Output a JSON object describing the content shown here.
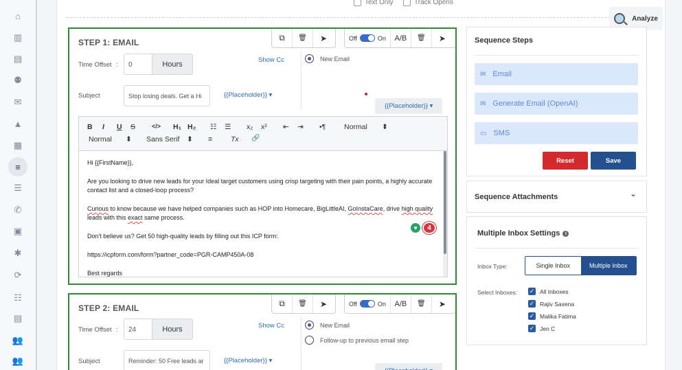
{
  "sidebar": {
    "icons": [
      "home-icon",
      "bank-icon",
      "contacts-icon",
      "users-icon",
      "mail-icon",
      "flask-icon",
      "campaign-icon",
      "sequence-icon",
      "tasks-icon",
      "phone-icon",
      "document-icon",
      "bug-icon",
      "refresh-icon",
      "list-icon",
      "report-icon",
      "team-icon"
    ],
    "glyphs": [
      "⌂",
      "▥",
      "▤",
      "⚉",
      "✉",
      "▲",
      "▦",
      "≡",
      "☰",
      "✆",
      "▣",
      "✱",
      "⟳",
      "☷",
      "▤",
      "👥"
    ],
    "active_index": 7
  },
  "top": {
    "text_only": "Text Only",
    "track_opens": "Track Opens",
    "analyze": "Analyze"
  },
  "step1": {
    "title": "STEP 1: EMAIL",
    "toolbar_toggle_off": "Off",
    "toolbar_toggle_on": "On",
    "ab": "A/B",
    "time_offset_label": "Time Offset",
    "colon": ":",
    "time_offset_value": "0",
    "unit": "Hours",
    "show_cc": "Show Cc",
    "radio_new_email": "New Email",
    "subject_label": "Subject",
    "subject_value": "Stop losing deals. Get a Hi",
    "placeholder": "{{Placeholder}}",
    "placeholder_caret": "▾",
    "editor": {
      "toolbar": {
        "bold": "B",
        "italic": "I",
        "underline": "U",
        "strike": "S",
        "code": "</>",
        "h1": "H₁",
        "h2": "H₂",
        "ol": "☷",
        "ul": "☰",
        "sub": "x₂",
        "sup": "x²",
        "outdent": "⇤",
        "indent": "⇥",
        "rtl": "•¶",
        "size_select": "Normal",
        "header_select": "Normal",
        "font_select": "Sans Serif",
        "select_caret": "⬍",
        "align": "≡",
        "clear": "Tx",
        "link": "🔗"
      },
      "greeting": "Hi {{FirstName}},",
      "p1": "Are you looking to drive new leads for your Ideal target customers using crisp targeting with their pain points, a highly accurate contact list and a closed-loop process?",
      "p2_a": "Curious",
      "p2_b": " to know because we have helped companies such as HOP into Homecare, BigLittleAI, ",
      "p2_c": "GoInstaCare",
      "p2_d": ", drive ",
      "p2_e": "high quality",
      "p2_f": " leads with this ",
      "p2_g": "exact",
      "p2_h": " same process.",
      "p3": "Don't believe us? Get 50 high-quality leads by filling out this ICP form:",
      "p4": "https://icpform.com/form?partner_code=PGR-CAMP450A-08",
      "p5": "Best regards",
      "grammar_count": "4",
      "grammar_glyph": "♥"
    }
  },
  "step2": {
    "title": "STEP 2: EMAIL",
    "toolbar_toggle_off": "Off",
    "toolbar_toggle_on": "On",
    "ab": "A/B",
    "time_offset_label": "Time Offset",
    "colon": ":",
    "time_offset_value": "24",
    "unit": "Hours",
    "show_cc": "Show Cc",
    "radio_new_email": "New Email",
    "radio_follow_up": "Follow-up to previous email step",
    "subject_label": "Subject",
    "subject_value": "Reminder: 50 Free leads ar",
    "placeholder": "{{Placeholder}}",
    "placeholder_caret": "▾"
  },
  "sequence_steps": {
    "title": "Sequence Steps",
    "items": [
      {
        "label": "Email",
        "icon": "mail-icon",
        "glyph": "✉"
      },
      {
        "label": "Generate Email (OpenAI)",
        "icon": "mail-icon",
        "glyph": "✉"
      },
      {
        "label": "SMS",
        "icon": "chat-icon",
        "glyph": "▭"
      }
    ],
    "reset": "Reset",
    "save": "Save"
  },
  "attachments": {
    "title": "Sequence Attachments",
    "chevron": "⌄"
  },
  "inbox_settings": {
    "title": "Multiple Inbox Settings",
    "info": "i",
    "inbox_type_label": "Inbox Type:",
    "single": "Single Inbox",
    "multiple": "Multiple Inbox",
    "select_label": "Select Inboxes:",
    "check": "✓",
    "inboxes": [
      "All Inboxes",
      "Rajiv Saxena",
      "Malika Fatima",
      "Jen C"
    ]
  },
  "toolbar_glyphs": {
    "copy": "⧉",
    "trash": "🗑",
    "send": "➤",
    "search": "🔍"
  }
}
